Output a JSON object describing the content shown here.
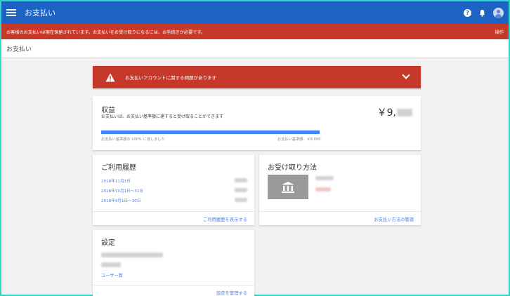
{
  "topbar": {
    "title": "お支払い",
    "help_icon_glyph": "?",
    "icons": [
      "menu-icon",
      "help-icon",
      "bell-icon",
      "avatar"
    ]
  },
  "hold_banner": {
    "message": "お客様のお支払いは現在保留されています。お支払いをお受け取りになるには、お手続きが必要です。",
    "action": "操作"
  },
  "subheader": {
    "title": "お支払い"
  },
  "issue_bar": {
    "text": "お支払いアカウントに関する問題があります",
    "icons": [
      "warning-icon",
      "chevron-down-icon"
    ]
  },
  "earnings": {
    "title": "収益",
    "description": "お支払いは、お支払い基準額に達すると受け取ることができます",
    "amount_prefix": "￥9,",
    "progress_fraction": 1.0,
    "progress_left_label": "お支払い基準額の 100% に達しました",
    "progress_right_label": "お支払い基準額：￥8,000"
  },
  "history": {
    "title": "ご利用履歴",
    "rows": [
      "2018年11月1日",
      "2018年10月1日～31日",
      "2018年9月1日～30日"
    ],
    "footer_link": "ご利用履歴を表示する"
  },
  "payout": {
    "title": "お受け取り方法",
    "footer_link": "お支払い方法の管理",
    "icon": "bank-icon"
  },
  "settings": {
    "title": "設定",
    "users_tab": "ユーザー数",
    "footer_link": "設定を管理する"
  },
  "colors": {
    "topbar": "#1c63c4",
    "alert_red": "#c6392a",
    "link_blue": "#4a7de0",
    "progress_blue": "#4285f4"
  }
}
